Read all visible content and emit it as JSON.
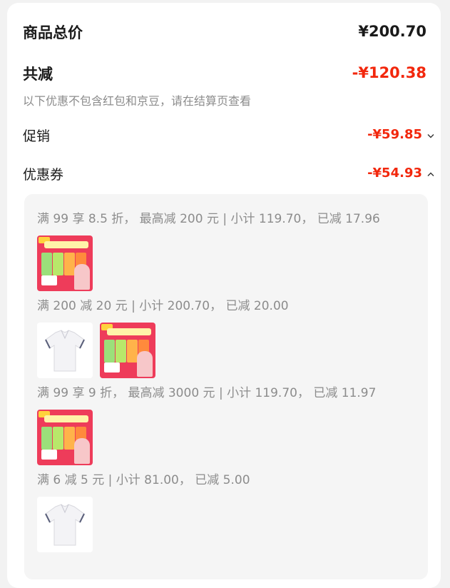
{
  "summary": {
    "total_label": "商品总价",
    "total_value": "¥200.70",
    "reduce_label": "共减",
    "reduce_value": "-¥120.38",
    "note": "以下优惠不包含红包和京豆，请在结算页查看",
    "promo_label": "促销",
    "promo_value": "-¥59.85",
    "coupon_label": "优惠券",
    "coupon_value": "-¥54.93"
  },
  "coupons": [
    {
      "rule": "满 99 享 8.5 折， 最高减 200 元 | 小计 119.70， 已减 17.96",
      "products": [
        "snack-box"
      ]
    },
    {
      "rule": "满 200 减 20 元 | 小计 200.70， 已减 20.00",
      "products": [
        "polo-shirt",
        "snack-box"
      ]
    },
    {
      "rule": "满 99 享 9 折， 最高减 3000 元 | 小计 119.70， 已减 11.97",
      "products": [
        "snack-box"
      ]
    },
    {
      "rule": "满 6 减 5 元 | 小计 81.00， 已减 5.00",
      "products": [
        "polo-shirt"
      ]
    }
  ],
  "colors": {
    "price_red": "#f2270c",
    "text_dark": "#1a1a1a",
    "text_gray": "#8c8c8c",
    "panel_bg": "#f5f5f5"
  },
  "icons": {
    "promo_toggle": "chevron-down-icon",
    "coupon_toggle": "chevron-up-icon"
  }
}
